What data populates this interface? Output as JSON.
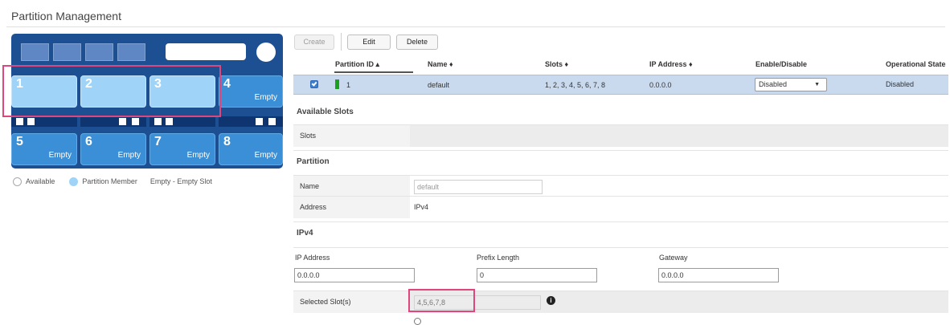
{
  "page": {
    "title": "Partition Management"
  },
  "chassis": {
    "slots_row1": [
      {
        "num": "1",
        "label": "",
        "state": "member"
      },
      {
        "num": "2",
        "label": "",
        "state": "member"
      },
      {
        "num": "3",
        "label": "",
        "state": "member"
      },
      {
        "num": "4",
        "label": "Empty",
        "state": "empty"
      }
    ],
    "slots_row2": [
      {
        "num": "5",
        "label": "Empty",
        "state": "empty"
      },
      {
        "num": "6",
        "label": "Empty",
        "state": "empty"
      },
      {
        "num": "7",
        "label": "Empty",
        "state": "empty"
      },
      {
        "num": "8",
        "label": "Empty",
        "state": "empty"
      }
    ],
    "colors": {
      "chassis": "#1d4f93",
      "member": "#9fd3f8",
      "empty": "#3a8fd6",
      "highlight": "#e0467e"
    }
  },
  "legend": {
    "available": "Available",
    "member": "Partition Member",
    "empty": "Empty - Empty Slot"
  },
  "toolbar": {
    "create": "Create",
    "edit": "Edit",
    "delete": "Delete"
  },
  "table": {
    "headers": {
      "partition_id": "Partition ID ▴",
      "name": "Name ♦",
      "slots": "Slots ♦",
      "ip": "IP Address ♦",
      "enable": "Enable/Disable",
      "state": "Operational State"
    },
    "row": {
      "id": "1",
      "name": "default",
      "slots": "1, 2, 3, 4, 5, 6, 7, 8",
      "ip": "0.0.0.0",
      "enable": "Disabled",
      "state": "Disabled",
      "status_color": "#1aa31a"
    }
  },
  "details": {
    "available_slots": {
      "title": "Available Slots",
      "slots_label": "Slots",
      "slots_value": ""
    },
    "partition": {
      "title": "Partition",
      "name_label": "Name",
      "name_value": "default",
      "address_label": "Address",
      "address_value": "IPv4"
    },
    "ipv4": {
      "title": "IPv4",
      "ip_label": "IP Address",
      "ip_value": "0.0.0.0",
      "prefix_label": "Prefix Length",
      "prefix_value": "0",
      "gateway_label": "Gateway",
      "gateway_value": "0.0.0.0"
    },
    "selected_slots": {
      "label": "Selected Slot(s)",
      "value": "4,5,6,7,8",
      "info_icon": "info-circle-icon"
    }
  }
}
